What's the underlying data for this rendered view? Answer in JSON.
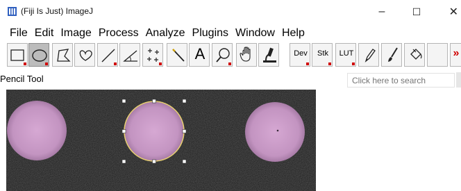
{
  "window": {
    "title": "(Fiji Is Just) ImageJ",
    "minimize_glyph": "–",
    "maximize_glyph": "☐",
    "close_glyph": "✕"
  },
  "menu": [
    "File",
    "Edit",
    "Image",
    "Process",
    "Analyze",
    "Plugins",
    "Window",
    "Help"
  ],
  "toolbar": {
    "tools": [
      {
        "name": "rectangle-tool",
        "icon": "rectangle-icon"
      },
      {
        "name": "oval-tool",
        "icon": "oval-icon",
        "selected": true
      },
      {
        "name": "polygon-tool",
        "icon": "polygon-icon"
      },
      {
        "name": "freehand-tool",
        "icon": "freehand-icon"
      },
      {
        "name": "line-tool",
        "icon": "line-icon"
      },
      {
        "name": "angle-tool",
        "icon": "angle-icon"
      },
      {
        "name": "point-tool",
        "icon": "multipoint-icon"
      },
      {
        "name": "wand-tool",
        "icon": "wand-icon"
      },
      {
        "name": "text-tool",
        "icon": "text-icon",
        "label": "A"
      },
      {
        "name": "magnifier-tool",
        "icon": "magnifier-icon"
      },
      {
        "name": "hand-tool",
        "icon": "hand-icon"
      },
      {
        "name": "color-picker-tool",
        "icon": "microscope-icon"
      },
      {
        "name": "dev-tool",
        "icon": "dev-icon",
        "label": "Dev"
      },
      {
        "name": "stk-tool",
        "icon": "stack-icon",
        "label": "Stk"
      },
      {
        "name": "lut-tool",
        "icon": "lut-icon",
        "label": "LUT"
      },
      {
        "name": "pencil-tool",
        "icon": "pencil-icon"
      },
      {
        "name": "brush-tool",
        "icon": "brush-icon"
      },
      {
        "name": "flood-fill-tool",
        "icon": "bucket-icon"
      },
      {
        "name": "more-tools",
        "icon": "more-icon",
        "label": "»"
      }
    ]
  },
  "status": {
    "text": "Pencil Tool",
    "search_placeholder": "Click here to search"
  },
  "colors": {
    "accent_red": "#d00000",
    "selection_yellow": "#e8d070",
    "spot_pink": "#c99ac8",
    "canvas_bg": "#1a1a1a"
  }
}
